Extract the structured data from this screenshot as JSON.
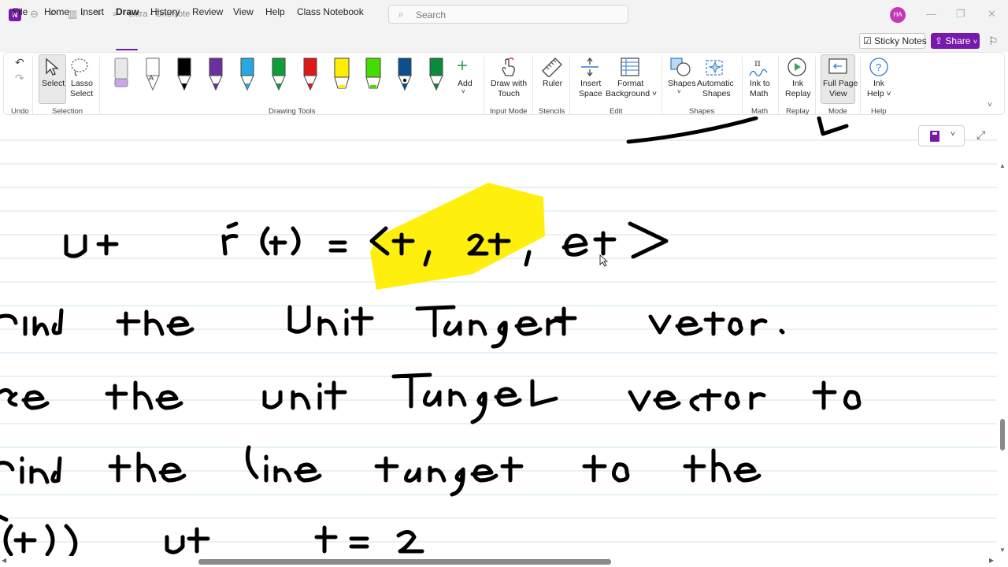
{
  "window": {
    "title": "extra - OneNote",
    "app_icon": "N",
    "avatar_initials": "HA",
    "search_placeholder": "Search"
  },
  "menu": {
    "items": [
      "File",
      "Home",
      "Insert",
      "Draw",
      "History",
      "Review",
      "View",
      "Help",
      "Class Notebook"
    ],
    "active": "Draw",
    "sticky_notes": "Sticky Notes",
    "share": "Share"
  },
  "ribbon": {
    "groups": {
      "undo": "Undo",
      "selection": "Selection",
      "drawing_tools": "Drawing Tools",
      "input_mode": "Input Mode",
      "stencils": "Stencils",
      "edit": "Edit",
      "shapes": "Shapes",
      "math": "Math",
      "replay": "Replay",
      "mode": "Mode",
      "help": "Help"
    },
    "buttons": {
      "select": "Select",
      "lasso_1": "Lasso",
      "lasso_2": "Select",
      "add": "Add",
      "draw_touch_1": "Draw with",
      "draw_touch_2": "Touch",
      "ruler": "Ruler",
      "insert_space_1": "Insert",
      "insert_space_2": "Space",
      "format_bg_1": "Format",
      "format_bg_2": "Background ˅",
      "shapes": "Shapes",
      "auto_shapes_1": "Automatic",
      "auto_shapes_2": "Shapes",
      "ink_math_1": "Ink to",
      "ink_math_2": "Math",
      "ink_replay_1": "Ink",
      "ink_replay_2": "Replay",
      "full_page_1": "Full Page",
      "full_page_2": "View",
      "ink_help_1": "Ink",
      "ink_help_2": "Help ˅"
    },
    "pen_colors": [
      "#e0e0e0",
      "#ffffff",
      "#000000",
      "#6b2fa0",
      "#29a8e0",
      "#0f9d3a",
      "#e01818",
      "#ffee00",
      "#44dd00",
      "#0b4f8c",
      "#0a8a3a"
    ]
  },
  "colors": {
    "accent": "#7719aa",
    "highlighter": "#ffee00",
    "rule_line": "#cfe3f2"
  }
}
